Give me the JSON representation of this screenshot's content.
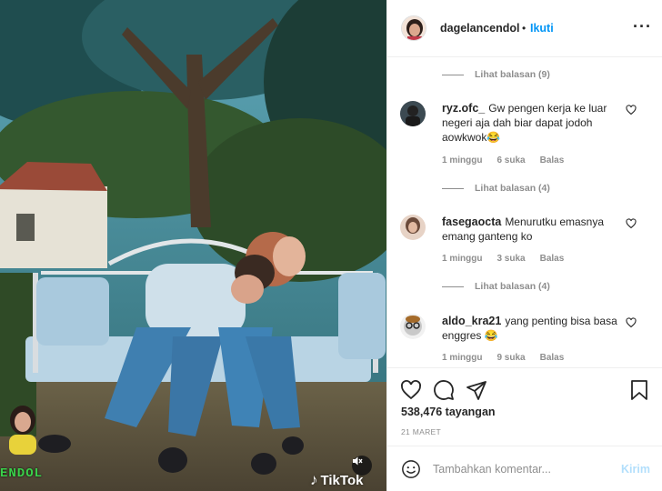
{
  "media": {
    "corner_label": "ENDOL",
    "watermark": "TikTok",
    "mute_icon": "speaker-muted-icon"
  },
  "header": {
    "username": "dagelancendol",
    "separator": "•",
    "follow_label": "Ikuti",
    "more_icon": "ellipsis-icon"
  },
  "comments": {
    "view_replies": [
      "Lihat balasan (9)",
      "Lihat balasan (4)",
      "Lihat balasan (4)"
    ],
    "items": [
      {
        "username": "ryz.ofc_",
        "text": "Gw pengen kerja ke luar negeri aja dah biar dapat jodoh aowkwok😂",
        "time": "1 minggu",
        "likes": "6 suka",
        "reply": "Balas"
      },
      {
        "username": "fasegaocta",
        "text": "Menurutku emasnya emang ganteng ko",
        "time": "1 minggu",
        "likes": "3 suka",
        "reply": "Balas"
      },
      {
        "username": "aldo_kra21",
        "text": "yang penting bisa basa enggres 😂",
        "time": "1 minggu",
        "likes": "9 suka",
        "reply": "Balas"
      }
    ]
  },
  "actions": {
    "views": "538,476 tayangan",
    "date": "21 MARET",
    "icons": [
      "heart-icon",
      "comment-icon",
      "share-icon",
      "bookmark-icon"
    ]
  },
  "add_comment": {
    "placeholder": "Tambahkan komentar...",
    "post_label": "Kirim"
  },
  "colors": {
    "accent": "#0095f6",
    "muted": "#8e8e8e",
    "post_disabled": "#b2dffc"
  }
}
